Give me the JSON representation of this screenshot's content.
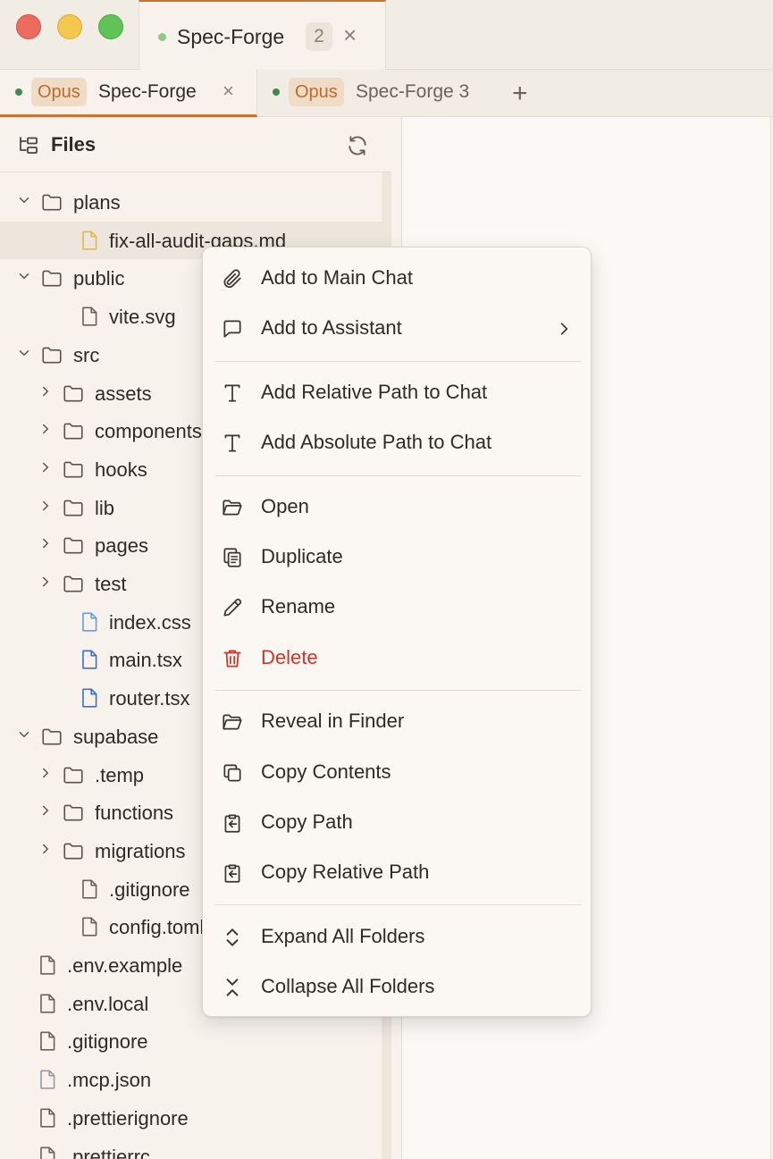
{
  "window": {
    "tab_title": "Spec-Forge",
    "tab_count": "2",
    "close_glyph": "×"
  },
  "session_tabs": [
    {
      "model": "Opus",
      "name": "Spec-Forge",
      "close": "×",
      "active": true
    },
    {
      "model": "Opus",
      "name": "Spec-Forge 3",
      "active": false
    }
  ],
  "new_tab_glyph": "+",
  "sidebar": {
    "title": "Files",
    "tree": [
      {
        "label": "plans",
        "type": "folder",
        "expanded": true
      },
      {
        "label": "fix-all-audit-gaps.md",
        "type": "file",
        "color": "#e8b74a"
      },
      {
        "label": "public",
        "type": "folder",
        "expanded": true
      },
      {
        "label": "vite.svg",
        "type": "file"
      },
      {
        "label": "src",
        "type": "folder",
        "expanded": true
      },
      {
        "label": "assets",
        "type": "folder",
        "expanded": false
      },
      {
        "label": "components",
        "type": "folder",
        "expanded": false
      },
      {
        "label": "hooks",
        "type": "folder",
        "expanded": false
      },
      {
        "label": "lib",
        "type": "folder",
        "expanded": false
      },
      {
        "label": "pages",
        "type": "folder",
        "expanded": false
      },
      {
        "label": "test",
        "type": "folder",
        "expanded": false
      },
      {
        "label": "index.css",
        "type": "file",
        "color": "#6c9bd6"
      },
      {
        "label": "main.tsx",
        "type": "file",
        "color": "#3f73c1"
      },
      {
        "label": "router.tsx",
        "type": "file",
        "color": "#3f73c1"
      },
      {
        "label": "supabase",
        "type": "folder",
        "expanded": true
      },
      {
        "label": ".temp",
        "type": "folder",
        "expanded": false
      },
      {
        "label": "functions",
        "type": "folder",
        "expanded": false
      },
      {
        "label": "migrations",
        "type": "folder",
        "expanded": false
      },
      {
        "label": ".gitignore",
        "type": "file"
      },
      {
        "label": "config.toml",
        "type": "file"
      },
      {
        "label": ".env.example",
        "type": "file"
      },
      {
        "label": ".env.local",
        "type": "file"
      },
      {
        "label": ".gitignore",
        "type": "file"
      },
      {
        "label": ".mcp.json",
        "type": "file",
        "color": "#9a9aa6"
      },
      {
        "label": ".prettierignore",
        "type": "file"
      },
      {
        "label": ".prettierrc",
        "type": "file"
      }
    ]
  },
  "context_menu": {
    "items": [
      {
        "label": "Add to Main Chat",
        "icon": "paperclip-icon"
      },
      {
        "label": "Add to Assistant",
        "icon": "chat-bubble-icon",
        "submenu": true
      },
      {
        "label": "Add Relative Path to Chat",
        "icon": "text-t-icon"
      },
      {
        "label": "Add Absolute Path to Chat",
        "icon": "text-t-icon"
      },
      {
        "label": "Open",
        "icon": "folder-open-icon"
      },
      {
        "label": "Duplicate",
        "icon": "duplicate-icon"
      },
      {
        "label": "Rename",
        "icon": "pencil-icon"
      },
      {
        "label": "Delete",
        "icon": "trash-icon",
        "danger": true
      },
      {
        "label": "Reveal in Finder",
        "icon": "folder-open-icon"
      },
      {
        "label": "Copy Contents",
        "icon": "copy-icon"
      },
      {
        "label": "Copy Path",
        "icon": "clipboard-arrow-icon"
      },
      {
        "label": "Copy Relative Path",
        "icon": "clipboard-arrow-icon"
      },
      {
        "label": "Expand All Folders",
        "icon": "expand-chevrons-icon"
      },
      {
        "label": "Collapse All Folders",
        "icon": "collapse-chevrons-icon"
      }
    ]
  },
  "colors": {
    "accent": "#c9733a",
    "danger": "#c6392e",
    "status_dot": "#3f8a4a"
  }
}
